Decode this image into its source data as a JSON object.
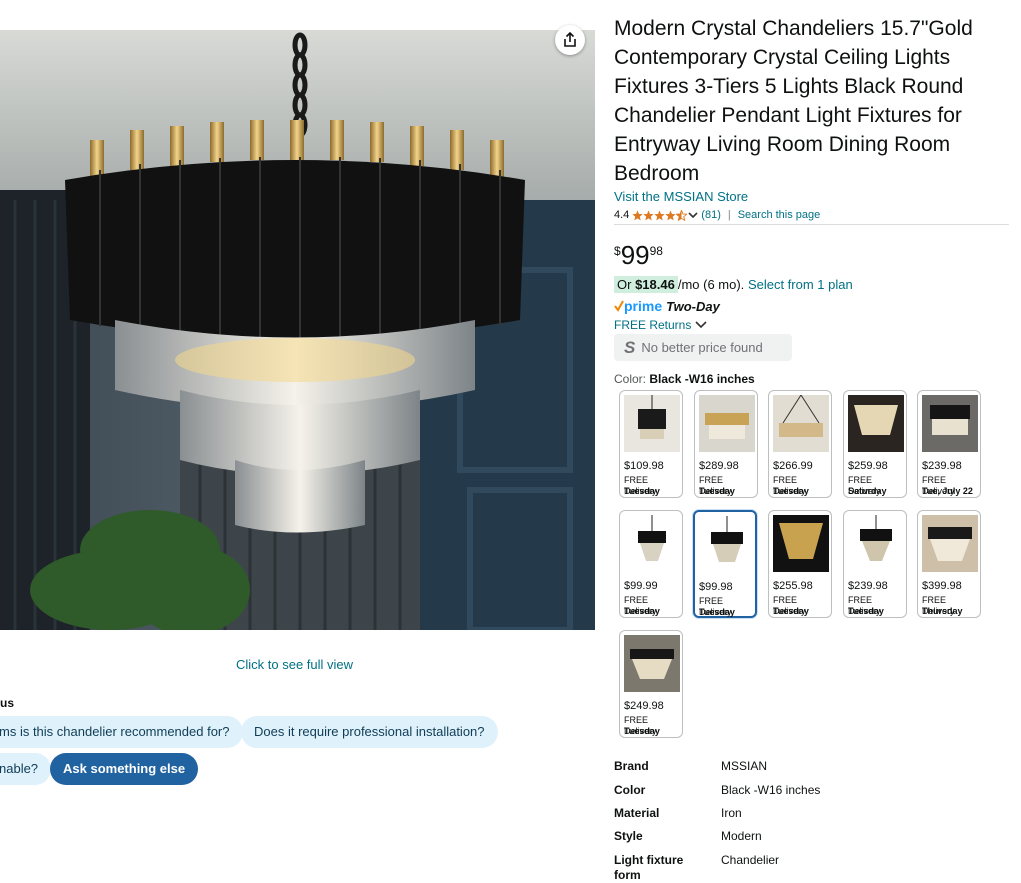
{
  "product": {
    "title": "Modern Crystal Chandeliers 15.7\"Gold Contemporary Crystal Ceiling Lights Fixtures 3-Tiers 5 Lights Black Round Chandelier Pendant Light Fixtures for Entryway Living Room Dining Room Bedroom",
    "store_link": "Visit the MSSIAN Store",
    "rating": "4.4",
    "rating_count": "(81)",
    "search_page": "Search this page",
    "price": {
      "symbol": "$",
      "whole": "99",
      "fraction": "98"
    },
    "monthly_prefix": "Or",
    "monthly_amount": "$18.46",
    "monthly_suffix": "/mo (6 mo).",
    "monthly_link": "Select from 1 plan",
    "prime_word": "prime",
    "prime_two_day": "Two-Day",
    "returns": "FREE Returns",
    "no_better_price": "No better price found",
    "color_label": "Color:",
    "color_value": "Black -W16 inches"
  },
  "image": {
    "full_view": "Click to see full view"
  },
  "rufus": {
    "title": "us",
    "questions": [
      "ms is this chandelier recommended for?",
      "Does it require professional installation?",
      "nable?",
      "Ask something else"
    ]
  },
  "swatches": [
    {
      "price": "$109.98",
      "delivery": "FREE Delivery",
      "day": "Tuesday"
    },
    {
      "price": "$289.98",
      "delivery": "FREE Delivery",
      "day": "Tuesday"
    },
    {
      "price": "$266.99",
      "delivery": "FREE Delivery",
      "day": "Tuesday"
    },
    {
      "price": "$259.98",
      "delivery": "FREE Delivery",
      "day": "Saturday"
    },
    {
      "price": "$239.98",
      "delivery": "FREE Delivery",
      "day": "Tue, July 22"
    },
    {
      "price": "$99.99",
      "delivery": "FREE Delivery",
      "day": "Tuesday"
    },
    {
      "price": "$99.98",
      "delivery": "FREE Delivery",
      "day": "Tuesday"
    },
    {
      "price": "$255.98",
      "delivery": "FREE Delivery",
      "day": "Tuesday"
    },
    {
      "price": "$239.98",
      "delivery": "FREE Delivery",
      "day": "Tuesday"
    },
    {
      "price": "$399.98",
      "delivery": "FREE Delivery",
      "day": "Thursday"
    },
    {
      "price": "$249.98",
      "delivery": "FREE Delivery",
      "day": "Tuesday"
    }
  ],
  "specs": [
    {
      "key": "Brand",
      "value": "MSSIAN"
    },
    {
      "key": "Color",
      "value": "Black -W16 inches"
    },
    {
      "key": "Material",
      "value": "Iron"
    },
    {
      "key": "Style",
      "value": "Modern"
    },
    {
      "key": "Light fixture form",
      "value": "Chandelier"
    }
  ],
  "colors": {
    "link": "#007185",
    "accent": "#2162a1",
    "star": "#de7921",
    "prime": "#1a98ff"
  }
}
